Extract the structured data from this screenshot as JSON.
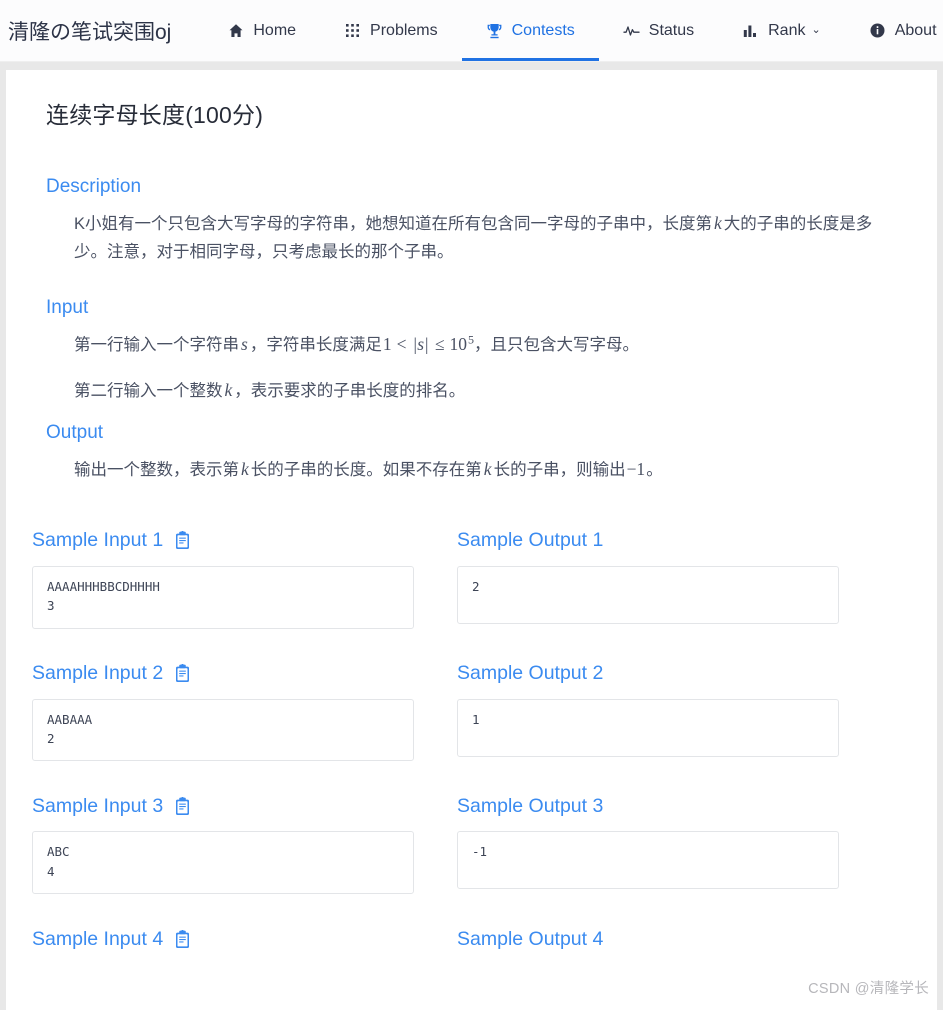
{
  "navbar": {
    "brand": "清隆の笔试突围oj",
    "items": [
      {
        "label": "Home",
        "icon": "home-icon",
        "active": false,
        "caret": ""
      },
      {
        "label": "Problems",
        "icon": "grid-icon",
        "active": false,
        "caret": ""
      },
      {
        "label": "Contests",
        "icon": "trophy-icon",
        "active": true,
        "caret": ""
      },
      {
        "label": "Status",
        "icon": "pulse-icon",
        "active": false,
        "caret": ""
      },
      {
        "label": "Rank",
        "icon": "bar-chart-icon",
        "active": false,
        "caret": "⌄"
      },
      {
        "label": "About",
        "icon": "info-icon",
        "active": false,
        "caret": "⌄"
      }
    ],
    "accent_color": "#2072e3",
    "text_color": "#32384a"
  },
  "problem": {
    "title": "连续字母长度(100分)",
    "sections": {
      "description": {
        "heading": "Description",
        "paragraphs": [
          "K小姐有一个只包含大写字母的字符串，她想知道在所有包含同一字母的子串中，长度第 k 大的子串的长度是多少。注意，对于相同字母，只考虑最长的那个子串。"
        ]
      },
      "input": {
        "heading": "Input",
        "paragraphs": [
          "第一行输入一个字符串 s，字符串长度满足 1 < |s| ≤ 10^5，且只包含大写字母。",
          "第二行输入一个整数 k，表示要求的子串长度的排名。"
        ]
      },
      "output": {
        "heading": "Output",
        "paragraphs": [
          "输出一个整数，表示第 k 长的子串的长度。如果不存在第 k 长的子串，则输出 −1。"
        ]
      }
    },
    "text_fragments": {
      "desc_a": "K小姐有一个只包含大写字母的字符串，她想知道在所有包含同一字母的子串中，长度第",
      "desc_k": "k",
      "desc_b": "大的子串的长度是多少。注意，对于相同字母，只考虑最长的那个子串。",
      "in1_a": "第一行输入一个字符串",
      "in1_s": "s",
      "in1_b": "，字符串长度满足",
      "in1_one": "1",
      "in1_lt": "<",
      "in1_abs": "|s|",
      "in1_le": "≤",
      "in1_ten": "10",
      "in1_exp": "5",
      "in1_c": "，且只包含大写字母。",
      "in2_a": "第二行输入一个整数",
      "in2_k": "k",
      "in2_b": "，表示要求的子串长度的排名。",
      "out_a": "输出一个整数，表示第",
      "out_k1": "k",
      "out_b": "长的子串的长度。如果不存在第",
      "out_k2": "k",
      "out_c": "长的子串，则输出",
      "out_minus1": "−1",
      "out_d": "。"
    },
    "samples": [
      {
        "input_label": "Sample Input 1",
        "output_label": "Sample Output 1",
        "input_text": "AAAAHHHBBCDHHHH\n3",
        "output_text": "2"
      },
      {
        "input_label": "Sample Input 2",
        "output_label": "Sample Output 2",
        "input_text": "AABAAA\n2",
        "output_text": "1"
      },
      {
        "input_label": "Sample Input 3",
        "output_label": "Sample Output 3",
        "input_text": "ABC\n4",
        "output_text": "-1"
      },
      {
        "input_label": "Sample Input 4",
        "output_label": "Sample Output 4",
        "input_text": "",
        "output_text": ""
      }
    ],
    "copy_icon": "clipboard-copy-icon"
  },
  "watermark": "CSDN @清隆学长"
}
